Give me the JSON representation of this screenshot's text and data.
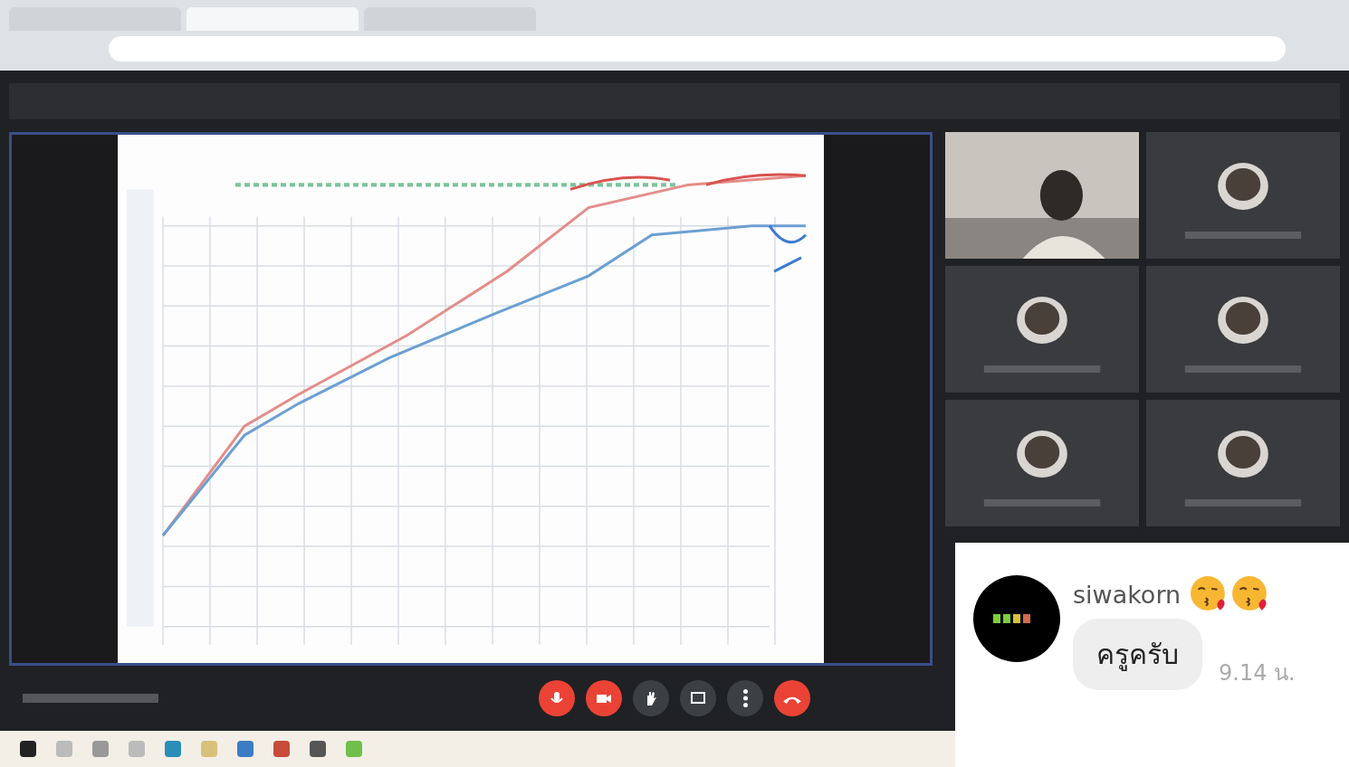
{
  "browser": {
    "tabs": [
      {
        "selected": false
      },
      {
        "selected": true
      },
      {
        "selected": false
      }
    ]
  },
  "meeting": {
    "tiles": [
      {
        "kind": "video"
      },
      {
        "kind": "avatar"
      },
      {
        "kind": "avatar"
      },
      {
        "kind": "avatar"
      },
      {
        "kind": "avatar"
      },
      {
        "kind": "avatar"
      }
    ],
    "controls": [
      {
        "kind": "mic",
        "danger": true
      },
      {
        "kind": "camera",
        "danger": true
      },
      {
        "kind": "hand",
        "danger": false
      },
      {
        "kind": "present",
        "danger": false
      },
      {
        "kind": "more",
        "danger": false
      },
      {
        "kind": "hangup",
        "danger": true
      }
    ]
  },
  "chat": {
    "messages": [
      {
        "sender": "siwakorn",
        "emoji": [
          {
            "kind": "kiss"
          },
          {
            "kind": "kiss"
          }
        ],
        "text": "ครูครับ",
        "time": "9.14 น."
      }
    ]
  }
}
